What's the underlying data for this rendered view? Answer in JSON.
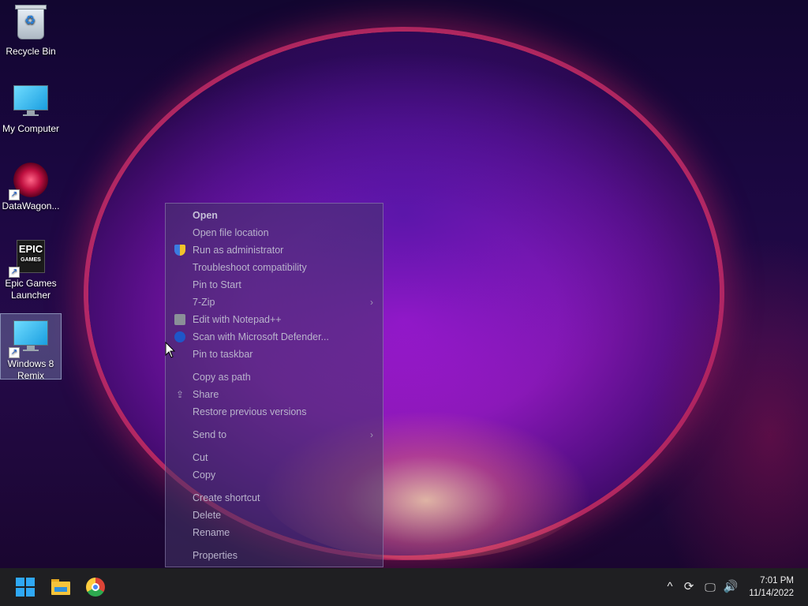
{
  "desktop": {
    "icons": [
      {
        "label": "Recycle Bin"
      },
      {
        "label": "My Computer"
      },
      {
        "label": "DataWagon..."
      },
      {
        "label": "Epic Games Launcher",
        "badge_line1": "EPIC",
        "badge_line2": "GAMES"
      },
      {
        "label": "Windows 8 Remix"
      }
    ]
  },
  "context_menu": {
    "items": [
      {
        "label": "Open"
      },
      {
        "label": "Open file location"
      },
      {
        "label": "Run as administrator",
        "icon": "shield-icon"
      },
      {
        "label": "Troubleshoot compatibility"
      },
      {
        "label": "Pin to Start"
      },
      {
        "label": "7-Zip",
        "submenu": true
      },
      {
        "label": "Edit with Notepad++",
        "icon": "notepad-icon"
      },
      {
        "label": "Scan with Microsoft Defender...",
        "icon": "defender-icon"
      },
      {
        "label": "Pin to taskbar"
      },
      {
        "label": "Copy as path"
      },
      {
        "label": "Share",
        "icon": "share-icon"
      },
      {
        "label": "Restore previous versions"
      },
      {
        "label": "Send to",
        "submenu": true
      },
      {
        "label": "Cut"
      },
      {
        "label": "Copy"
      },
      {
        "label": "Create shortcut"
      },
      {
        "label": "Delete"
      },
      {
        "label": "Rename"
      },
      {
        "label": "Properties"
      }
    ],
    "submenu_glyph": "›"
  },
  "taskbar": {
    "apps": [
      "start-button",
      "file-explorer",
      "chrome"
    ],
    "tray": {
      "chevron": "^",
      "time": "7:01 PM",
      "date": "11/14/2022"
    }
  },
  "colors": {
    "accent": "#2fa8f5",
    "taskbar": "#1f1f22",
    "menu_text": "#b9b3cc"
  }
}
